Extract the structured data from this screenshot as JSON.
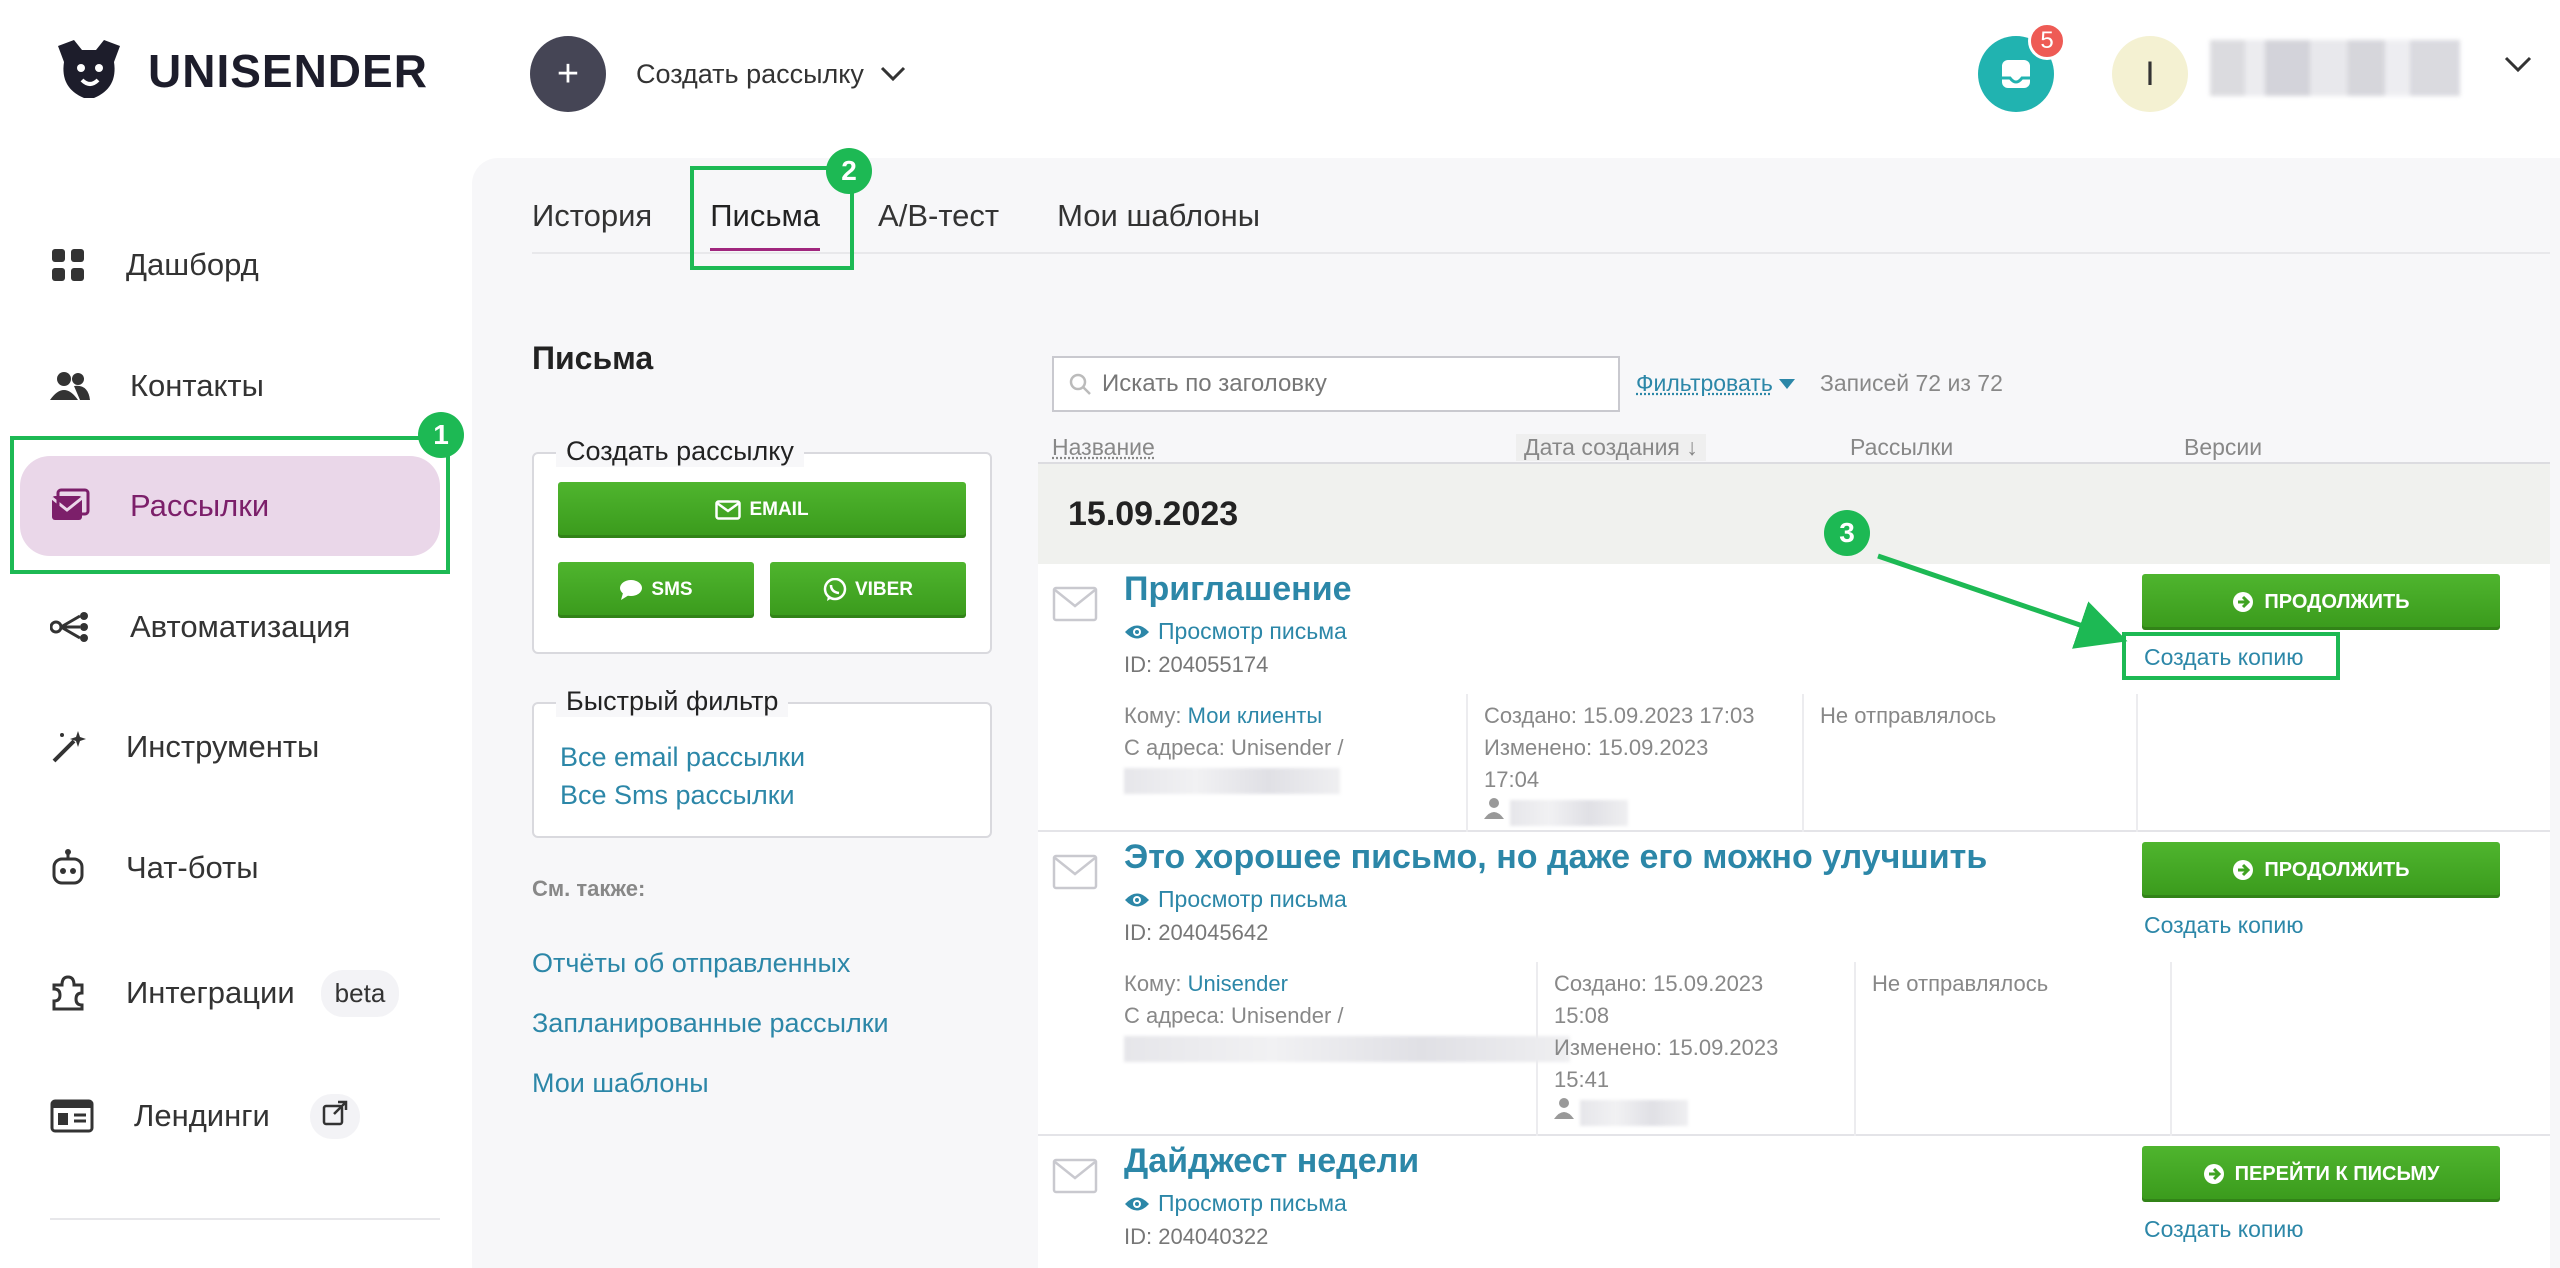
{
  "header": {
    "brand": "UNISENDER",
    "create_label": "Создать рассылку",
    "plus": "+",
    "notification_count": "5",
    "avatar_initial": "I"
  },
  "sidebar": {
    "items": [
      {
        "label": "Дашборд",
        "icon": "grid-icon"
      },
      {
        "label": "Контакты",
        "icon": "users-icon"
      },
      {
        "label": "Рассылки",
        "icon": "mail-icon",
        "active": true
      },
      {
        "label": "Автоматизация",
        "icon": "nodes-icon"
      },
      {
        "label": "Инструменты",
        "icon": "wand-icon"
      },
      {
        "label": "Чат-боты",
        "icon": "bot-icon"
      },
      {
        "label": "Интеграции",
        "icon": "puzzle-icon",
        "badge": "beta"
      },
      {
        "label": "Лендинги",
        "icon": "layout-icon"
      }
    ]
  },
  "annotations": [
    "1",
    "2",
    "3"
  ],
  "tabs": [
    "История",
    "Письма",
    "A/B-тест",
    "Мои шаблоны"
  ],
  "left": {
    "section_title": "Письма",
    "create_card_title": "Создать рассылку",
    "btn_email": "EMAIL",
    "btn_sms": "SMS",
    "btn_viber": "VIBER",
    "filter_card_title": "Быстрый фильтр",
    "filter_all_email": "Все email рассылки",
    "filter_all_sms": "Все Sms рассылки",
    "see_also": "См. также:",
    "links": [
      "Отчёты об отправленных",
      "Запланированные рассылки",
      "Мои шаблоны"
    ]
  },
  "list": {
    "search_placeholder": "Искать по заголовку",
    "filter_label": "Фильтровать",
    "records": "Записей 72 из 72",
    "columns": [
      "Название",
      "Дата создания ↓",
      "Рассылки",
      "Версии"
    ],
    "date_group": "15.09.2023",
    "view_label": "Просмотр письма",
    "copy_label": "Создать копию",
    "to_prefix": "Кому:",
    "from_prefix": "С адреса: Unisender /",
    "rows": [
      {
        "title": "Приглашение",
        "id": "ID: 204055174",
        "to": "Мои клиенты",
        "created": "Создано: 15.09.2023 17:03",
        "modified_1": "Изменено: 15.09.2023",
        "modified_2": "17:04",
        "status": "Не отправлялось",
        "action": "ПРОДОЛЖИТЬ"
      },
      {
        "title": "Это хорошее письмо, но даже его можно улучшить",
        "id": "ID: 204045642",
        "to": "Unisender",
        "created_1": "Создано: 15.09.2023",
        "created_2": "15:08",
        "modified_1": "Изменено: 15.09.2023",
        "modified_2": "15:41",
        "status": "Не отправлялось",
        "action": "ПРОДОЛЖИТЬ"
      },
      {
        "title": "Дайджест недели",
        "id": "ID: 204040322",
        "action": "ПЕРЕЙТИ К ПИСЬМУ"
      }
    ]
  },
  "colors": {
    "accent_green": "#3fa222",
    "link_blue": "#2c87a8",
    "active_bg": "#ead7e9",
    "active_text": "#7c1f6a",
    "highlight": "#1db954"
  }
}
